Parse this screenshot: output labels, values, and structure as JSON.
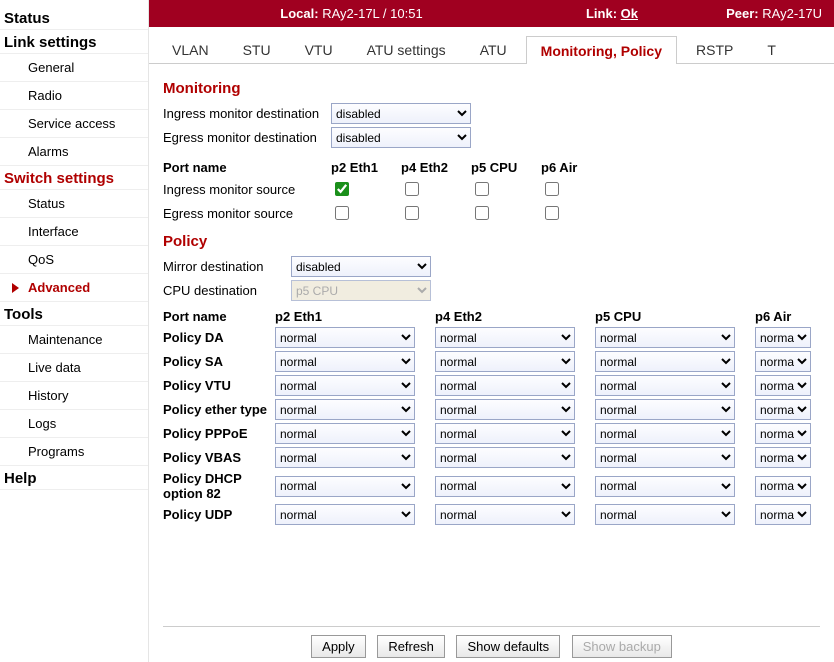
{
  "topbar": {
    "local_label": "Local:",
    "local_value": "RAy2-17L / 10:51",
    "link_label": "Link:",
    "link_value": "Ok",
    "peer_label": "Peer:",
    "peer_value": "RAy2-17U"
  },
  "sidebar": {
    "groups": [
      {
        "label": "Status",
        "items": []
      },
      {
        "label": "Link settings",
        "items": [
          {
            "label": "General"
          },
          {
            "label": "Radio"
          },
          {
            "label": "Service access"
          },
          {
            "label": "Alarms"
          }
        ]
      },
      {
        "label": "Switch settings",
        "red": true,
        "items": [
          {
            "label": "Status"
          },
          {
            "label": "Interface"
          },
          {
            "label": "QoS"
          },
          {
            "label": "Advanced",
            "active": true
          }
        ]
      },
      {
        "label": "Tools",
        "items": [
          {
            "label": "Maintenance"
          },
          {
            "label": "Live data"
          },
          {
            "label": "History"
          },
          {
            "label": "Logs"
          },
          {
            "label": "Programs"
          }
        ]
      },
      {
        "label": "Help",
        "items": []
      }
    ]
  },
  "tabs": [
    "VLAN",
    "STU",
    "VTU",
    "ATU settings",
    "ATU",
    "Monitoring, Policy",
    "RSTP",
    "T"
  ],
  "active_tab": 5,
  "monitoring": {
    "title": "Monitoring",
    "ingress_dest_label": "Ingress monitor destination",
    "ingress_dest_value": "disabled",
    "egress_dest_label": "Egress monitor destination",
    "egress_dest_value": "disabled",
    "port_name_label": "Port name",
    "ports": [
      "p2 Eth1",
      "p4 Eth2",
      "p5 CPU",
      "p6 Air"
    ],
    "ingress_src_label": "Ingress monitor source",
    "ingress_src": [
      true,
      false,
      false,
      false
    ],
    "egress_src_label": "Egress monitor source",
    "egress_src": [
      false,
      false,
      false,
      false
    ]
  },
  "policy": {
    "title": "Policy",
    "mirror_label": "Mirror destination",
    "mirror_value": "disabled",
    "cpu_label": "CPU destination",
    "cpu_value": "p5 CPU",
    "port_name_label": "Port name",
    "ports": [
      "p2 Eth1",
      "p4 Eth2",
      "p5 CPU",
      "p6 Air"
    ],
    "rows": [
      {
        "label": "Policy DA",
        "v": [
          "normal",
          "normal",
          "normal",
          "norma"
        ]
      },
      {
        "label": "Policy SA",
        "v": [
          "normal",
          "normal",
          "normal",
          "norma"
        ]
      },
      {
        "label": "Policy VTU",
        "v": [
          "normal",
          "normal",
          "normal",
          "norma"
        ]
      },
      {
        "label": "Policy ether type",
        "v": [
          "normal",
          "normal",
          "normal",
          "norma"
        ]
      },
      {
        "label": "Policy PPPoE",
        "v": [
          "normal",
          "normal",
          "normal",
          "norma"
        ]
      },
      {
        "label": "Policy VBAS",
        "v": [
          "normal",
          "normal",
          "normal",
          "norma"
        ]
      },
      {
        "label": "Policy DHCP option 82",
        "v": [
          "normal",
          "normal",
          "normal",
          "norma"
        ]
      },
      {
        "label": "Policy UDP",
        "v": [
          "normal",
          "normal",
          "normal",
          "norma"
        ]
      }
    ]
  },
  "buttons": {
    "apply": "Apply",
    "refresh": "Refresh",
    "show_defaults": "Show defaults",
    "show_backup": "Show backup"
  }
}
